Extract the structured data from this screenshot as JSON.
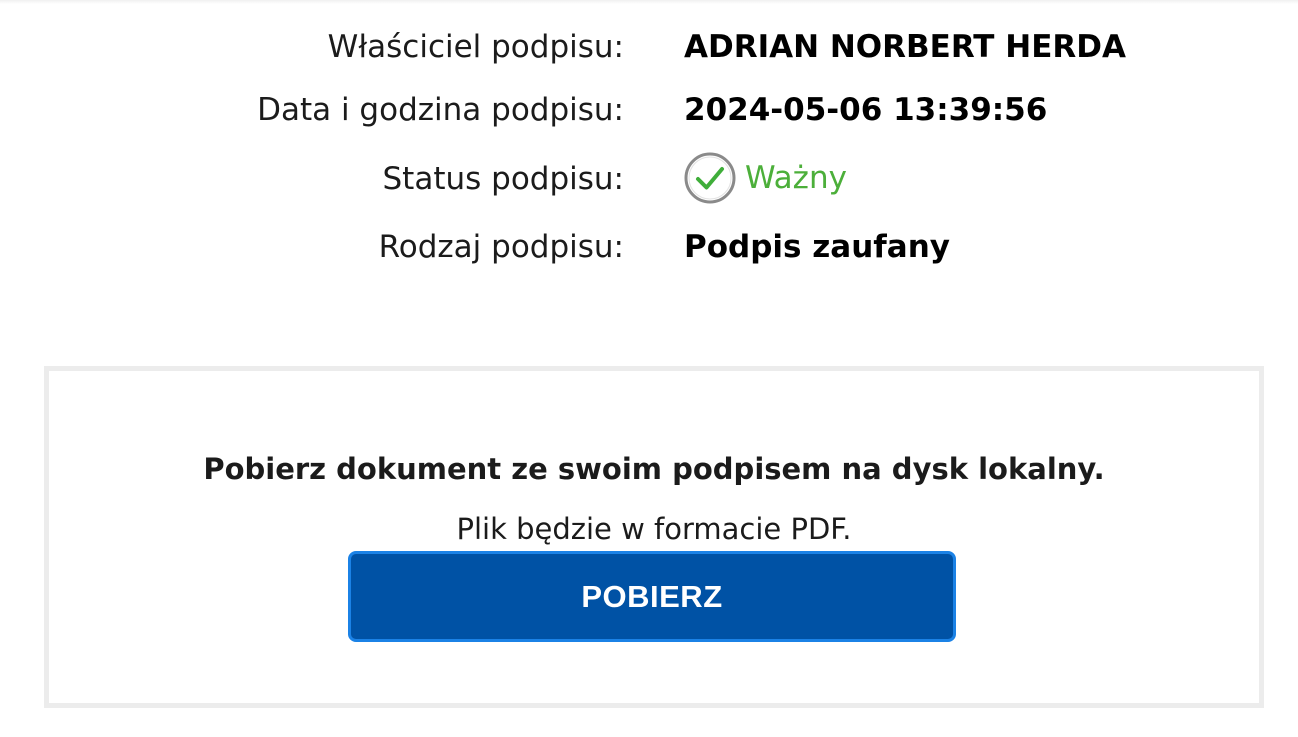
{
  "signature": {
    "owner_label": "Właściciel podpisu:",
    "owner_value": "ADRIAN NORBERT HERDA",
    "date_label": "Data i godzina podpisu:",
    "date_value": "2024-05-06 13:39:56",
    "status_label": "Status podpisu:",
    "status_value": "Ważny",
    "status_icon": "check-circle-icon",
    "status_color": "#4caf3a",
    "type_label": "Rodzaj podpisu:",
    "type_value": "Podpis zaufany"
  },
  "download": {
    "heading": "Pobierz dokument ze swoim podpisem na dysk lokalny.",
    "subtext": "Plik będzie w formacie PDF.",
    "button_label": "POBIERZ",
    "button_color": "#0052a5"
  }
}
